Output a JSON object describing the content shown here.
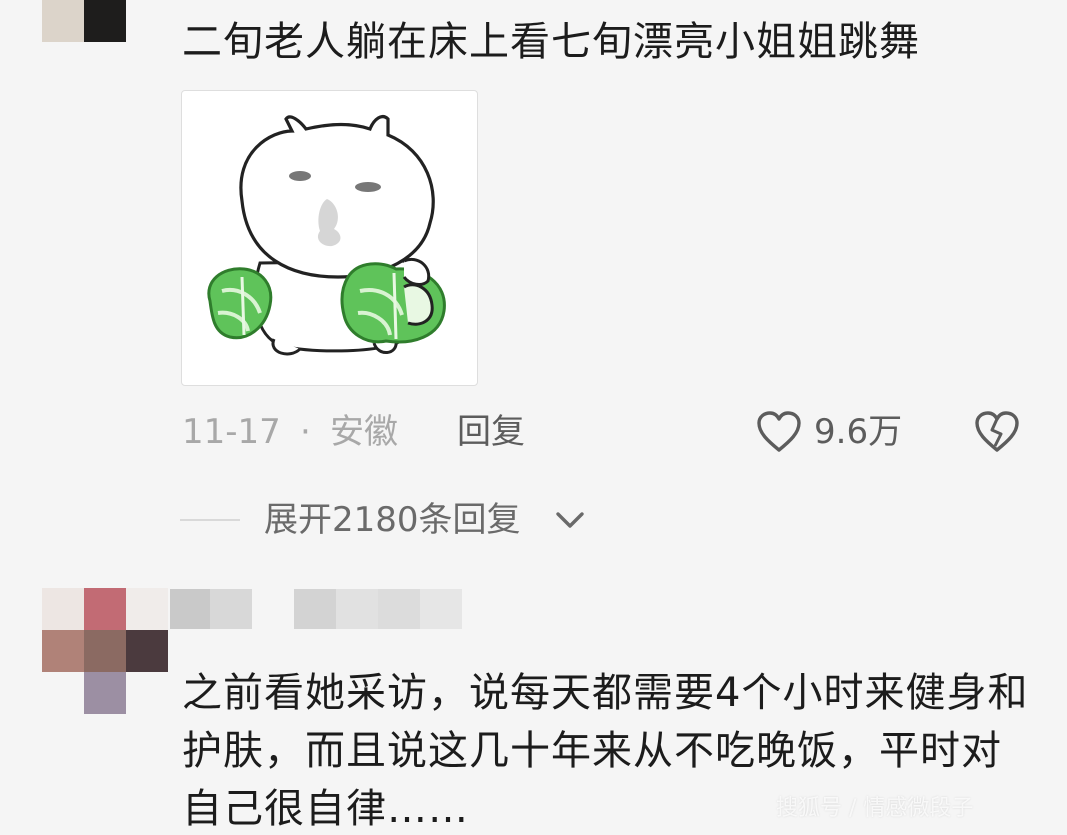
{
  "comment1": {
    "text": "二旬老人躺在床上看七旬漂亮小姐姐跳舞",
    "sticker_icon": "cat-holding-cabbage-sticker",
    "date": "11-17",
    "separator": "·",
    "location": "安徽",
    "reply_label": "回复",
    "like_icon": "heart-outline-icon",
    "like_count": "9.6万",
    "dislike_icon": "broken-heart-icon",
    "expand_label": "展开2180条回复",
    "expand_icon": "chevron-down-icon"
  },
  "comment2": {
    "avatar": "pixelated-avatar",
    "text": "之前看她采访，说每天都需要4个小时来健身和护肤，而且说这几十年来从不吃晚饭，平时对自己很自律……"
  },
  "watermark": "搜狐号 / 情感微段子",
  "colors": {
    "background": "#f5f5f5",
    "primary_text": "#1c1c1c",
    "secondary_text": "#a8a8a8",
    "action_text": "#5c5c5c",
    "cabbage_green": "#5fc35a"
  }
}
